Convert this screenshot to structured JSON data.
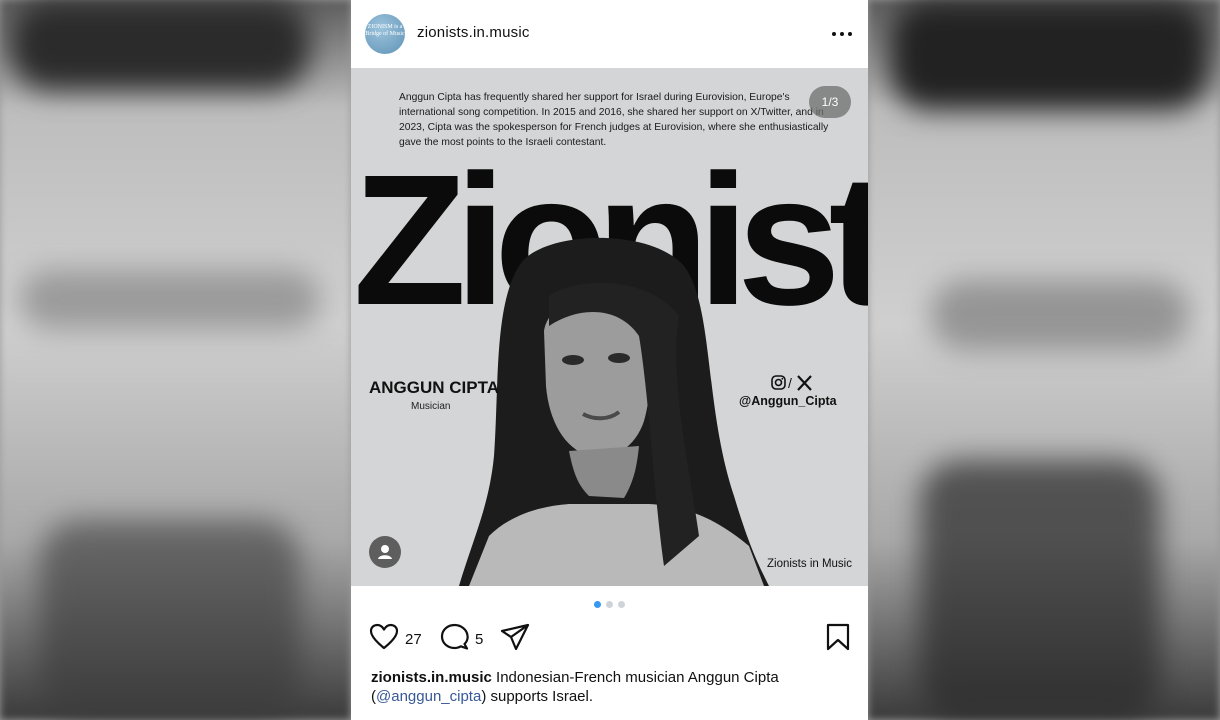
{
  "post": {
    "username": "zionists.in.music",
    "avatar_text": "ZIONISM is a Bridge of Music",
    "carousel_counter": "1/3",
    "carousel_total": 3,
    "carousel_index": 1,
    "image": {
      "description": "Anggun Cipta has frequently shared her support for Israel during Eurovision, Europe's international song competition. In 2015 and 2016, she shared her support on X/Twitter, and in 2023, Cipta was the spokesperson for French judges at Eurovision, where she enthusiastically gave the most points to the Israeli contestant.",
      "headline": "Zionist",
      "person_name": "ANGGUN CIPTA",
      "person_role": "Musician",
      "social_separator": "/",
      "social_handle": "@Anggun_Cipta",
      "watermark": "Zionists in Music"
    },
    "likes": "27",
    "comments": "5",
    "caption": {
      "username": "zionists.in.music",
      "text_before": "Indonesian-French musician Anggun Cipta (",
      "mention": "@anggun_cipta",
      "text_after": ") supports Israel."
    }
  },
  "colors": {
    "accent_blue": "#3897f0",
    "mention_blue": "#385898",
    "image_bg": "#d4d5d6"
  },
  "icons": [
    "more-icon",
    "heart-icon",
    "comment-icon",
    "share-icon",
    "bookmark-icon",
    "user-tag-icon",
    "instagram-icon",
    "x-icon"
  ]
}
